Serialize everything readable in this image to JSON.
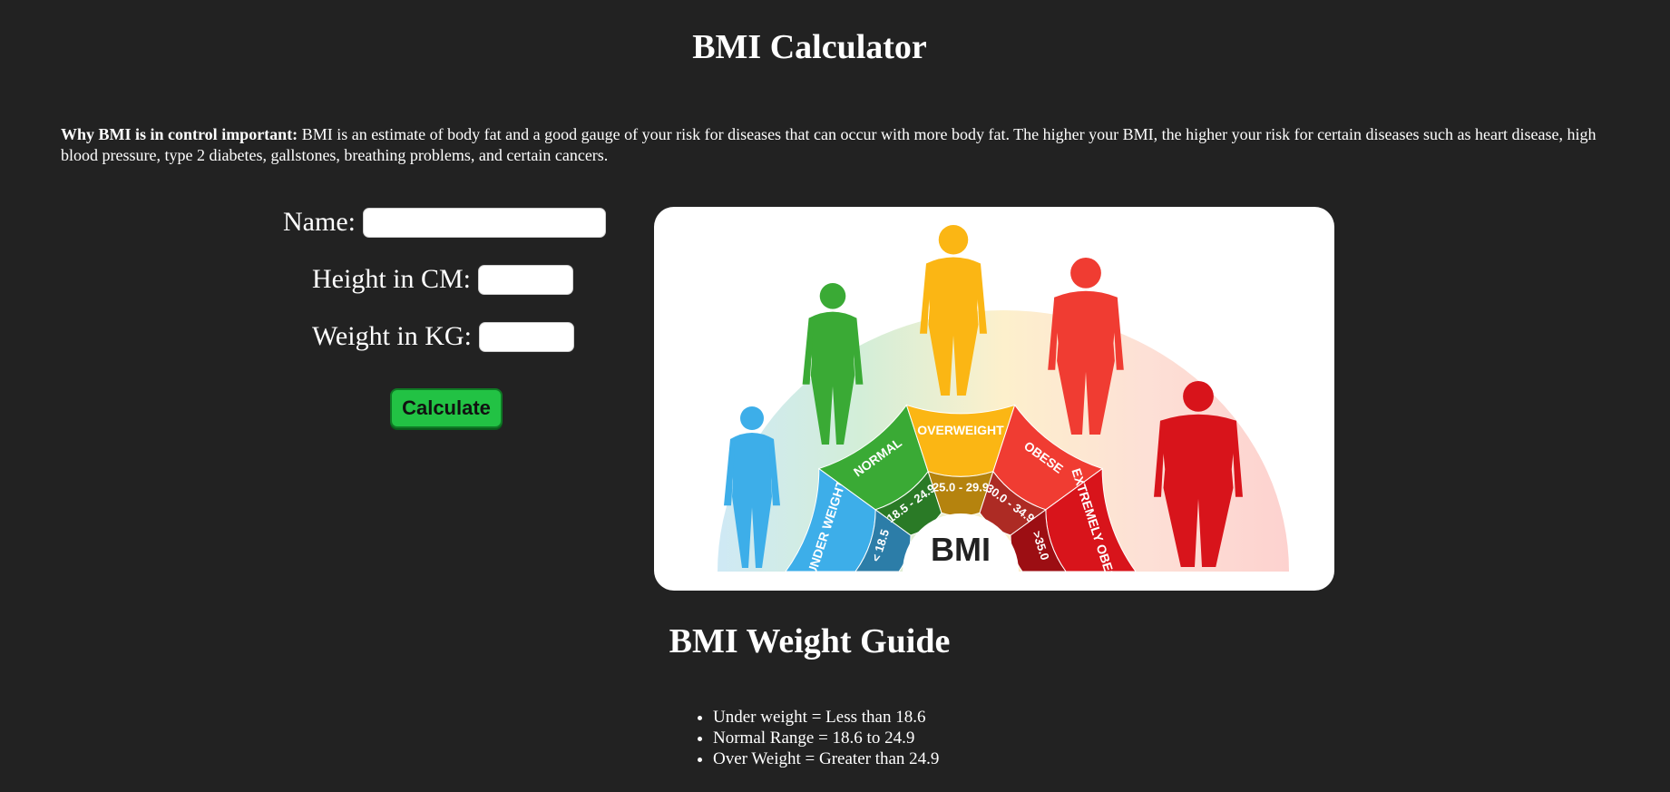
{
  "page": {
    "title": "BMI Calculator",
    "intro_bold": "Why BMI is in control important:",
    "intro_text": " BMI is an estimate of body fat and a good gauge of your risk for diseases that can occur with more body fat. The higher your BMI, the higher your risk for certain diseases such as heart disease, high blood pressure, type 2 diabetes, gallstones, breathing problems, and certain cancers."
  },
  "form": {
    "name_label": "Name:",
    "name_value": "",
    "height_label": "Height in CM:",
    "height_value": "",
    "weight_label": "Weight in KG:",
    "weight_value": "",
    "calculate_label": "Calculate"
  },
  "bmi_chart": {
    "center_label": "BMI",
    "categories": [
      {
        "label": "UNDER WEIGHT",
        "range": "< 18.5",
        "color": "#3daee9"
      },
      {
        "label": "NORMAL",
        "range": "18.5 - 24.9",
        "color": "#3aaa35"
      },
      {
        "label": "OVERWEIGHT",
        "range": "25.0 - 29.9",
        "color": "#fbb614"
      },
      {
        "label": "OBESE",
        "range": "30.0 - 34.9",
        "color": "#f03c32"
      },
      {
        "label": "EXTREMELY OBESE",
        "range": ">35.0",
        "color": "#d8141b"
      }
    ]
  },
  "guide": {
    "title": "BMI Weight Guide",
    "items": [
      "Under weight = Less than 18.6",
      "Normal Range = 18.6 to 24.9",
      "Over Weight = Greater than 24.9"
    ]
  }
}
